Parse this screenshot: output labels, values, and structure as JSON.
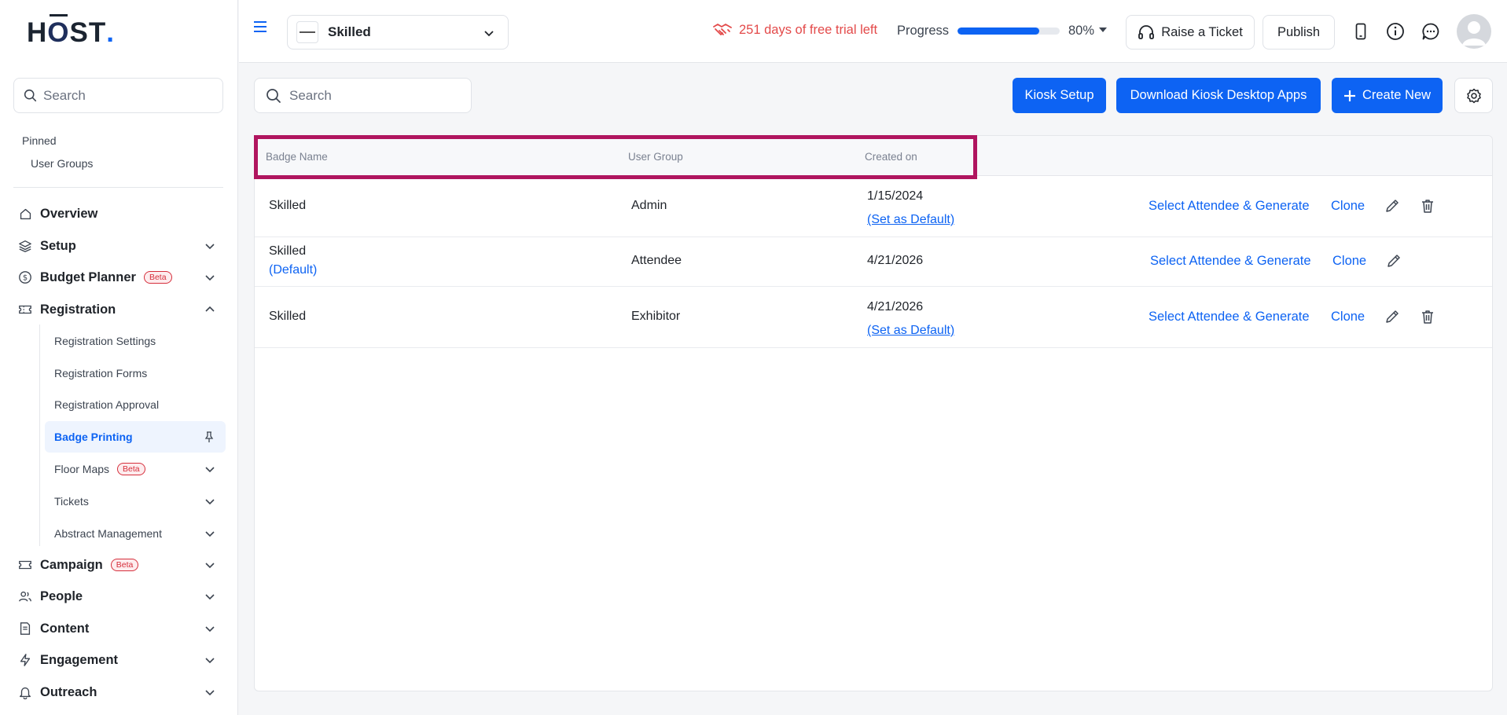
{
  "brand": {
    "logo_h": "H",
    "logo_o": "O",
    "logo_rest": "ST",
    "logo_dot": "."
  },
  "sidebar": {
    "search_placeholder": "Search",
    "pinned_title": "Pinned",
    "pinned_items": [
      "User Groups"
    ],
    "nav": [
      {
        "label": "Overview"
      },
      {
        "label": "Setup"
      },
      {
        "label": "Budget Planner",
        "badge": "Beta"
      },
      {
        "label": "Registration"
      },
      {
        "label": "Campaign",
        "badge": "Beta"
      },
      {
        "label": "People"
      },
      {
        "label": "Content"
      },
      {
        "label": "Engagement"
      },
      {
        "label": "Outreach"
      }
    ],
    "registration_sub": [
      {
        "label": "Registration Settings"
      },
      {
        "label": "Registration Forms"
      },
      {
        "label": "Registration Approval"
      },
      {
        "label": "Badge Printing"
      },
      {
        "label": "Floor Maps",
        "badge": "Beta"
      },
      {
        "label": "Tickets"
      },
      {
        "label": "Abstract Management"
      }
    ]
  },
  "topbar": {
    "event_name": "Skilled",
    "trial_text": "251 days of free trial left",
    "progress_label": "Progress",
    "progress_value": "80%",
    "progress_fraction": 0.8,
    "raise_ticket": "Raise a Ticket",
    "publish": "Publish"
  },
  "main": {
    "search_placeholder": "Search",
    "kiosk_setup": "Kiosk Setup",
    "download_kiosk": "Download Kiosk Desktop Apps",
    "create_new": "Create New"
  },
  "table": {
    "headers": {
      "badge_name": "Badge Name",
      "user_group": "User Group",
      "created_on": "Created on"
    },
    "rows": [
      {
        "badge_name": "Skilled",
        "default_tag": "",
        "user_group": "Admin",
        "created_on": "1/15/2024",
        "set_default": "(Set as Default)",
        "generate": "Select Attendee & Generate",
        "clone": "Clone"
      },
      {
        "badge_name": "Skilled",
        "default_tag": "(Default)",
        "user_group": "Attendee",
        "created_on": "4/21/2026",
        "set_default": "",
        "generate": "Select Attendee & Generate",
        "clone": "Clone"
      },
      {
        "badge_name": "Skilled",
        "default_tag": "",
        "user_group": "Exhibitor",
        "created_on": "4/21/2026",
        "set_default": "(Set as Default)",
        "generate": "Select Attendee & Generate",
        "clone": "Clone"
      }
    ]
  },
  "colors": {
    "accent": "#0d63f3",
    "highlight": "#b0155f",
    "trial": "#e34a4a",
    "beta": "#d62f3c"
  }
}
